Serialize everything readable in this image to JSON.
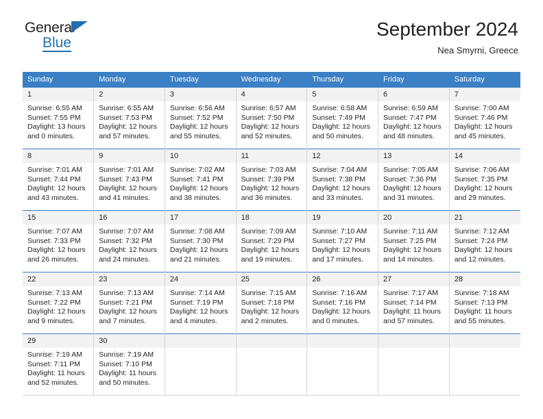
{
  "brand": {
    "name_part1": "General",
    "name_part2": "Blue"
  },
  "header": {
    "title": "September 2024",
    "subtitle": "Nea Smyrni, Greece"
  },
  "colors": {
    "header_blue": "#3b7fc4",
    "logo_blue": "#1f6fb2",
    "daynum_band": "#f2f2f2",
    "text": "#231f20"
  },
  "weekdays": [
    "Sunday",
    "Monday",
    "Tuesday",
    "Wednesday",
    "Thursday",
    "Friday",
    "Saturday"
  ],
  "weeks": [
    [
      {
        "day": "1",
        "sunrise": "Sunrise: 6:55 AM",
        "sunset": "Sunset: 7:55 PM",
        "daylight1": "Daylight: 13 hours",
        "daylight2": "and 0 minutes."
      },
      {
        "day": "2",
        "sunrise": "Sunrise: 6:55 AM",
        "sunset": "Sunset: 7:53 PM",
        "daylight1": "Daylight: 12 hours",
        "daylight2": "and 57 minutes."
      },
      {
        "day": "3",
        "sunrise": "Sunrise: 6:56 AM",
        "sunset": "Sunset: 7:52 PM",
        "daylight1": "Daylight: 12 hours",
        "daylight2": "and 55 minutes."
      },
      {
        "day": "4",
        "sunrise": "Sunrise: 6:57 AM",
        "sunset": "Sunset: 7:50 PM",
        "daylight1": "Daylight: 12 hours",
        "daylight2": "and 52 minutes."
      },
      {
        "day": "5",
        "sunrise": "Sunrise: 6:58 AM",
        "sunset": "Sunset: 7:49 PM",
        "daylight1": "Daylight: 12 hours",
        "daylight2": "and 50 minutes."
      },
      {
        "day": "6",
        "sunrise": "Sunrise: 6:59 AM",
        "sunset": "Sunset: 7:47 PM",
        "daylight1": "Daylight: 12 hours",
        "daylight2": "and 48 minutes."
      },
      {
        "day": "7",
        "sunrise": "Sunrise: 7:00 AM",
        "sunset": "Sunset: 7:46 PM",
        "daylight1": "Daylight: 12 hours",
        "daylight2": "and 45 minutes."
      }
    ],
    [
      {
        "day": "8",
        "sunrise": "Sunrise: 7:01 AM",
        "sunset": "Sunset: 7:44 PM",
        "daylight1": "Daylight: 12 hours",
        "daylight2": "and 43 minutes."
      },
      {
        "day": "9",
        "sunrise": "Sunrise: 7:01 AM",
        "sunset": "Sunset: 7:43 PM",
        "daylight1": "Daylight: 12 hours",
        "daylight2": "and 41 minutes."
      },
      {
        "day": "10",
        "sunrise": "Sunrise: 7:02 AM",
        "sunset": "Sunset: 7:41 PM",
        "daylight1": "Daylight: 12 hours",
        "daylight2": "and 38 minutes."
      },
      {
        "day": "11",
        "sunrise": "Sunrise: 7:03 AM",
        "sunset": "Sunset: 7:39 PM",
        "daylight1": "Daylight: 12 hours",
        "daylight2": "and 36 minutes."
      },
      {
        "day": "12",
        "sunrise": "Sunrise: 7:04 AM",
        "sunset": "Sunset: 7:38 PM",
        "daylight1": "Daylight: 12 hours",
        "daylight2": "and 33 minutes."
      },
      {
        "day": "13",
        "sunrise": "Sunrise: 7:05 AM",
        "sunset": "Sunset: 7:36 PM",
        "daylight1": "Daylight: 12 hours",
        "daylight2": "and 31 minutes."
      },
      {
        "day": "14",
        "sunrise": "Sunrise: 7:06 AM",
        "sunset": "Sunset: 7:35 PM",
        "daylight1": "Daylight: 12 hours",
        "daylight2": "and 29 minutes."
      }
    ],
    [
      {
        "day": "15",
        "sunrise": "Sunrise: 7:07 AM",
        "sunset": "Sunset: 7:33 PM",
        "daylight1": "Daylight: 12 hours",
        "daylight2": "and 26 minutes."
      },
      {
        "day": "16",
        "sunrise": "Sunrise: 7:07 AM",
        "sunset": "Sunset: 7:32 PM",
        "daylight1": "Daylight: 12 hours",
        "daylight2": "and 24 minutes."
      },
      {
        "day": "17",
        "sunrise": "Sunrise: 7:08 AM",
        "sunset": "Sunset: 7:30 PM",
        "daylight1": "Daylight: 12 hours",
        "daylight2": "and 21 minutes."
      },
      {
        "day": "18",
        "sunrise": "Sunrise: 7:09 AM",
        "sunset": "Sunset: 7:29 PM",
        "daylight1": "Daylight: 12 hours",
        "daylight2": "and 19 minutes."
      },
      {
        "day": "19",
        "sunrise": "Sunrise: 7:10 AM",
        "sunset": "Sunset: 7:27 PM",
        "daylight1": "Daylight: 12 hours",
        "daylight2": "and 17 minutes."
      },
      {
        "day": "20",
        "sunrise": "Sunrise: 7:11 AM",
        "sunset": "Sunset: 7:25 PM",
        "daylight1": "Daylight: 12 hours",
        "daylight2": "and 14 minutes."
      },
      {
        "day": "21",
        "sunrise": "Sunrise: 7:12 AM",
        "sunset": "Sunset: 7:24 PM",
        "daylight1": "Daylight: 12 hours",
        "daylight2": "and 12 minutes."
      }
    ],
    [
      {
        "day": "22",
        "sunrise": "Sunrise: 7:13 AM",
        "sunset": "Sunset: 7:22 PM",
        "daylight1": "Daylight: 12 hours",
        "daylight2": "and 9 minutes."
      },
      {
        "day": "23",
        "sunrise": "Sunrise: 7:13 AM",
        "sunset": "Sunset: 7:21 PM",
        "daylight1": "Daylight: 12 hours",
        "daylight2": "and 7 minutes."
      },
      {
        "day": "24",
        "sunrise": "Sunrise: 7:14 AM",
        "sunset": "Sunset: 7:19 PM",
        "daylight1": "Daylight: 12 hours",
        "daylight2": "and 4 minutes."
      },
      {
        "day": "25",
        "sunrise": "Sunrise: 7:15 AM",
        "sunset": "Sunset: 7:18 PM",
        "daylight1": "Daylight: 12 hours",
        "daylight2": "and 2 minutes."
      },
      {
        "day": "26",
        "sunrise": "Sunrise: 7:16 AM",
        "sunset": "Sunset: 7:16 PM",
        "daylight1": "Daylight: 12 hours",
        "daylight2": "and 0 minutes."
      },
      {
        "day": "27",
        "sunrise": "Sunrise: 7:17 AM",
        "sunset": "Sunset: 7:14 PM",
        "daylight1": "Daylight: 11 hours",
        "daylight2": "and 57 minutes."
      },
      {
        "day": "28",
        "sunrise": "Sunrise: 7:18 AM",
        "sunset": "Sunset: 7:13 PM",
        "daylight1": "Daylight: 11 hours",
        "daylight2": "and 55 minutes."
      }
    ],
    [
      {
        "day": "29",
        "sunrise": "Sunrise: 7:19 AM",
        "sunset": "Sunset: 7:11 PM",
        "daylight1": "Daylight: 11 hours",
        "daylight2": "and 52 minutes."
      },
      {
        "day": "30",
        "sunrise": "Sunrise: 7:19 AM",
        "sunset": "Sunset: 7:10 PM",
        "daylight1": "Daylight: 11 hours",
        "daylight2": "and 50 minutes."
      },
      {
        "day": "",
        "sunrise": "",
        "sunset": "",
        "daylight1": "",
        "daylight2": ""
      },
      {
        "day": "",
        "sunrise": "",
        "sunset": "",
        "daylight1": "",
        "daylight2": ""
      },
      {
        "day": "",
        "sunrise": "",
        "sunset": "",
        "daylight1": "",
        "daylight2": ""
      },
      {
        "day": "",
        "sunrise": "",
        "sunset": "",
        "daylight1": "",
        "daylight2": ""
      },
      {
        "day": "",
        "sunrise": "",
        "sunset": "",
        "daylight1": "",
        "daylight2": ""
      }
    ]
  ]
}
